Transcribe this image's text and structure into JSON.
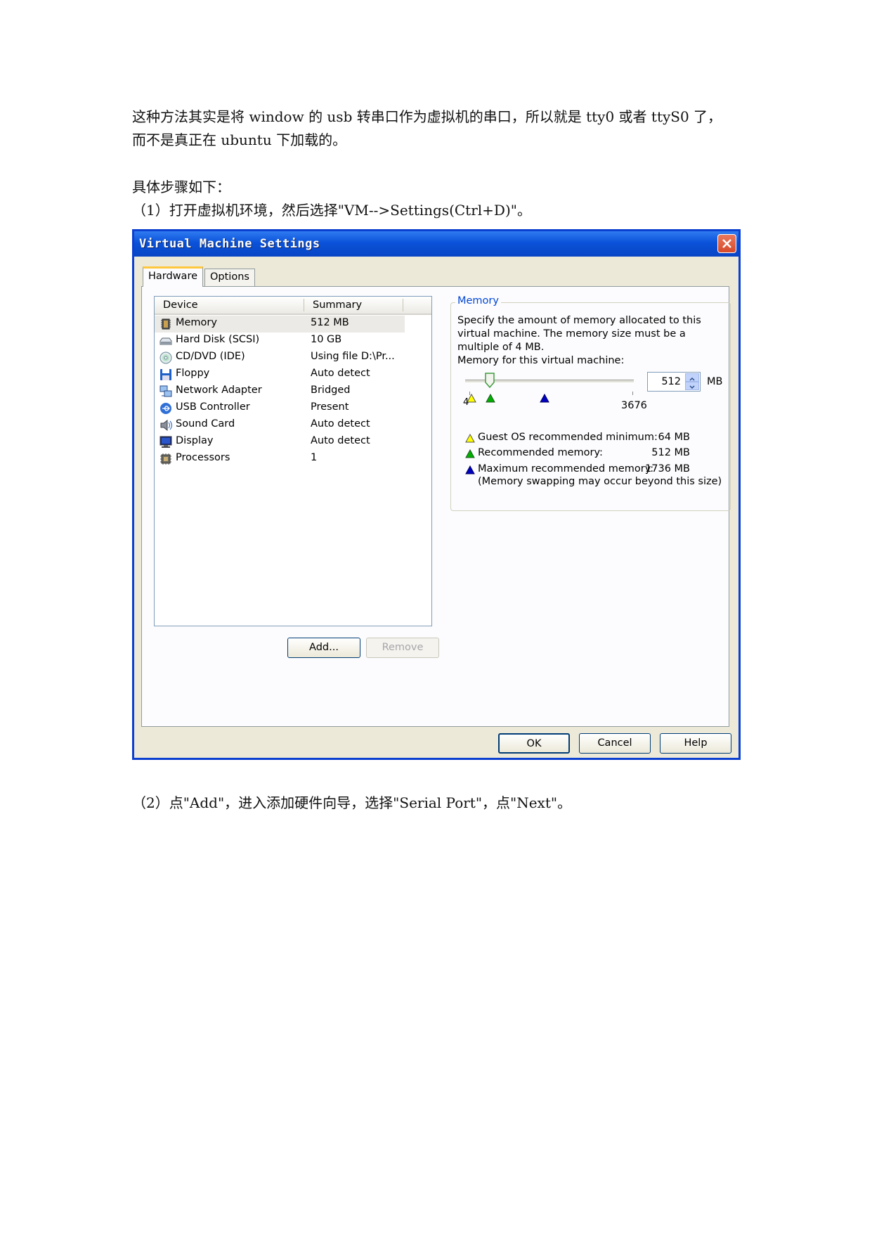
{
  "document": {
    "paragraph1": [
      "这种方法其实是将 window 的 usb 转串口作为虚拟机的串口，所以就是 tty0 或者 ttyS0 了，",
      "而不是真正在 ubuntu 下加载的。"
    ],
    "paragraph2": [
      "具体步骤如下：",
      "（1）打开虚拟机环境，然后选择\"VM-->Settings(Ctrl+D)\"。"
    ],
    "paragraph3": "（2）点\"Add\"，进入添加硬件向导，选择\"Serial Port\"，点\"Next\"。"
  },
  "dialog": {
    "title": "Virtual Machine Settings",
    "tabs": [
      "Hardware",
      "Options"
    ],
    "active_tab": "Hardware",
    "device_list": {
      "columns": [
        "Device",
        "Summary"
      ],
      "rows": [
        {
          "device": "Memory",
          "summary": "512 MB",
          "icon": "memory-icon",
          "selected": true
        },
        {
          "device": "Hard Disk (SCSI)",
          "summary": "10 GB",
          "icon": "hard-disk-icon"
        },
        {
          "device": "CD/DVD (IDE)",
          "summary": "Using file D:\\Pr...",
          "icon": "cd-dvd-icon"
        },
        {
          "device": "Floppy",
          "summary": "Auto detect",
          "icon": "floppy-icon"
        },
        {
          "device": "Network Adapter",
          "summary": "Bridged",
          "icon": "network-adapter-icon"
        },
        {
          "device": "USB Controller",
          "summary": "Present",
          "icon": "usb-icon"
        },
        {
          "device": "Sound Card",
          "summary": "Auto detect",
          "icon": "sound-card-icon"
        },
        {
          "device": "Display",
          "summary": "Auto detect",
          "icon": "display-icon"
        },
        {
          "device": "Processors",
          "summary": "1",
          "icon": "processor-icon"
        }
      ]
    },
    "buttons": {
      "add": "Add...",
      "remove": "Remove",
      "ok": "OK",
      "cancel": "Cancel",
      "help": "Help"
    },
    "memory": {
      "group_title": "Memory",
      "description": "Specify the amount of memory allocated to this virtual machine. The memory size must be a multiple of 4 MB.",
      "field_label": "Memory for this virtual machine:",
      "value": "512",
      "unit": "MB",
      "slider_min": "4",
      "slider_max": "3676",
      "legend": [
        {
          "label": "Guest OS recommended minimum:",
          "value": "64 MB",
          "color": "#ffff00"
        },
        {
          "label": "Recommended memory:",
          "value": "512 MB",
          "color": "#00b000"
        },
        {
          "label": "Maximum recommended memory:",
          "value": "1736 MB",
          "color": "#0000c0"
        }
      ],
      "note": "(Memory swapping may occur beyond this size)"
    }
  }
}
